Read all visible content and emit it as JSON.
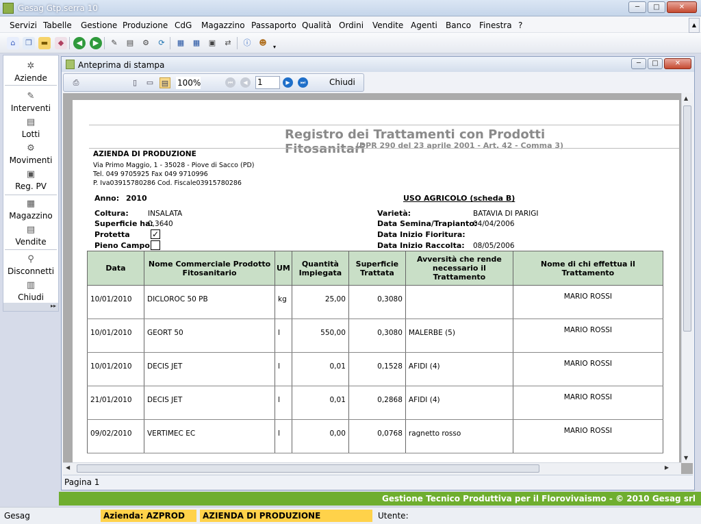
{
  "window": {
    "title": "Gesag Gtp.serra 10",
    "min": "─",
    "max": "□",
    "close": "✕"
  },
  "menu": [
    "Servizi",
    "Tabelle",
    "Gestione",
    "Produzione",
    "CdG",
    "Magazzino",
    "Passaporto",
    "Qualità",
    "Ordini",
    "Vendite",
    "Agenti",
    "Banco",
    "Finestra",
    "?"
  ],
  "sidebar": {
    "items": [
      {
        "label": "Aziende",
        "icon": "asterisk-icon"
      },
      {
        "label": "Interventi",
        "icon": "interventi-icon"
      },
      {
        "label": "Lotti",
        "icon": "lotti-icon"
      },
      {
        "label": "Movimenti",
        "icon": "movimenti-icon"
      },
      {
        "label": "Reg. PV",
        "icon": "registro-icon"
      },
      {
        "label": "Magazzino",
        "icon": "magazzino-icon"
      },
      {
        "label": "Vendite",
        "icon": "vendite-icon"
      },
      {
        "label": "Disconnetti",
        "icon": "disconnect-icon"
      },
      {
        "label": "Chiudi",
        "icon": "exit-icon"
      }
    ]
  },
  "preview": {
    "title": "Anteprima di stampa",
    "zoom": "100%",
    "page": "1",
    "close_label": "Chiudi",
    "status": "Pagina 1"
  },
  "report": {
    "title": "Registro dei Trattamenti con Prodotti Fitosanitari",
    "subtitle": "(DPR 290 del 23 aprile 2001 - Art. 42 - Comma 3)",
    "company": {
      "name": "AZIENDA DI PRODUZIONE",
      "address": "Via Primo Maggio, 1 - 35028 - Piove di Sacco (PD)",
      "phone": "Tel. 049 9705925   Fax 049 9710996",
      "tax": "P. Iva03915780286 Cod. Fiscale03915780286"
    },
    "anno_label": "Anno:",
    "anno": "2010",
    "uso": "USO AGRICOLO (scheda B)",
    "coltura_label": "Coltura:",
    "coltura": "INSALATA",
    "superficie_label": "Superficie ha:",
    "superficie": "0,3640",
    "protetta_label": "Protetta",
    "protetta_checked": "✓",
    "pieno_campo_label": "Pieno Campo",
    "varieta_label": "Varietà:",
    "varieta": "BATAVIA DI PARIGI",
    "semina_label": "Data Semina/Trapianto:",
    "semina": "04/04/2006",
    "fioritura_label": "Data Inizio Fioritura:",
    "raccolta_label": "Data Inizio Raccolta:",
    "raccolta": "08/05/2006",
    "columns": [
      "Data",
      "Nome Commerciale Prodotto Fitosanitario",
      "UM",
      "Quantità Impiegata",
      "Superficie Trattata",
      "Avversità che rende necessario il Trattamento",
      "Nome di chi effettua il Trattamento"
    ],
    "rows": [
      [
        "10/01/2010",
        "DICLOROC 50 PB",
        "kg",
        "25,00",
        "0,3080",
        "",
        "MARIO ROSSI"
      ],
      [
        "10/01/2010",
        "GEORT 50",
        "l",
        "550,00",
        "0,3080",
        "MALERBE (5)",
        "MARIO ROSSI"
      ],
      [
        "10/01/2010",
        "DECIS JET",
        "l",
        "0,01",
        "0,1528",
        "AFIDI (4)",
        "MARIO ROSSI"
      ],
      [
        "21/01/2010",
        "DECIS JET",
        "l",
        "0,01",
        "0,2868",
        "AFIDI (4)",
        "MARIO ROSSI"
      ],
      [
        "09/02/2010",
        "VERTIMEC EC",
        "l",
        "0,00",
        "0,0768",
        "ragnetto rosso",
        "MARIO ROSSI"
      ]
    ]
  },
  "footer": "Gestione Tecnico Produttiva per il Florovivaismo - © 2010 Gesag srl",
  "status": {
    "app": "Gesag",
    "azienda": "Azienda: AZPROD",
    "azienda_name": "AZIENDA DI PRODUZIONE",
    "utente": "Utente:"
  },
  "colors": {
    "footer_green": "#6fae2f",
    "table_header": "#c9dfc7",
    "status_yellow": "#ffd24a"
  }
}
